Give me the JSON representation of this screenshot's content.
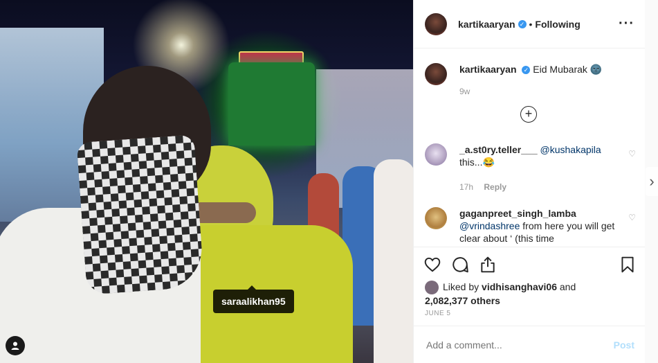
{
  "photo": {
    "tagged_user": "saraalikhan95",
    "user_tag_icon": "person-icon",
    "next_icon": "chevron-right-icon"
  },
  "header": {
    "username": "kartikaaryan",
    "verified_icon": "verified-badge-icon",
    "separator": "•",
    "follow_state": "Following",
    "more_icon": "ellipsis-icon"
  },
  "caption": {
    "username": "kartikaaryan",
    "text": "Eid Mubarak",
    "emoji": "🌚",
    "age": "9w"
  },
  "comments": [
    {
      "username": "_a.st0ry.teller___",
      "mention": "@kushakapila",
      "text": "this...😂",
      "age": "17h",
      "reply_label": "Reply"
    },
    {
      "username": "gaganpreet_singh_lamba",
      "mention": "@vrindashree",
      "text": "from here you will get clear about ‘ (this time"
    }
  ],
  "actions": {
    "like_icon": "heart-icon",
    "comment_icon": "comment-icon",
    "share_icon": "share-icon",
    "save_icon": "bookmark-icon"
  },
  "likes": {
    "prefix": "Liked by",
    "liker": "vidhisanghavi06",
    "and": "and",
    "others": "2,082,377 others"
  },
  "date": "JUNE 5",
  "add_comment": {
    "placeholder": "Add a comment...",
    "post_label": "Post"
  }
}
